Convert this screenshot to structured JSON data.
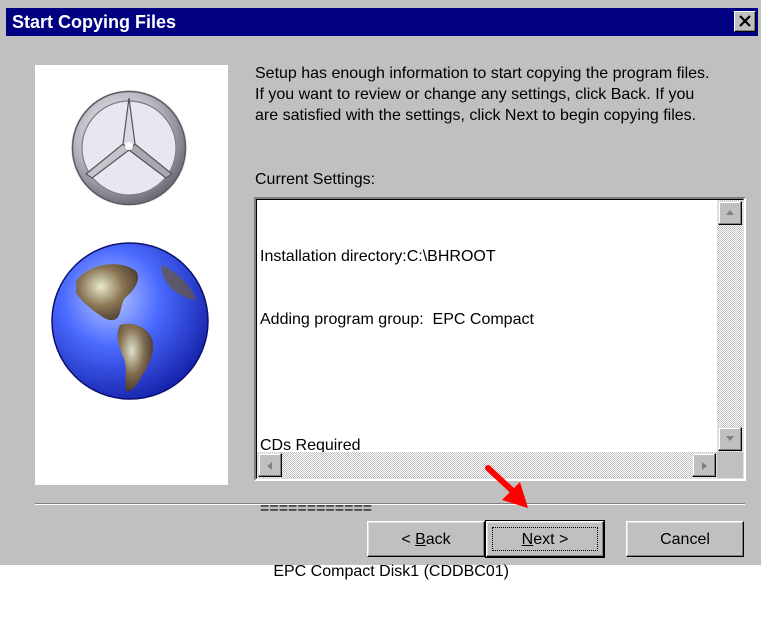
{
  "window": {
    "title": "Start Copying Files",
    "title_bar_color": "#000080",
    "background_color": "#c0c0c0"
  },
  "intro": {
    "lines": [
      "Setup has enough information to start copying the program files.",
      "If you want to review or change any settings, click Back.  If you",
      "are satisfied with the settings, click Next to begin copying files."
    ]
  },
  "settings": {
    "label": "Current Settings:",
    "lines": [
      "Installation directory:C:\\BHROOT",
      "Adding program group:  EPC Compact",
      "",
      "CDs Required",
      "============",
      "   EPC Compact Disk1 (CDDBC01)"
    ]
  },
  "buttons": {
    "back": {
      "prefix": "< ",
      "accel": "B",
      "rest": "ack"
    },
    "next": {
      "accel": "N",
      "rest": "ext >"
    },
    "cancel": "Cancel"
  },
  "icons": {
    "close": "close-icon",
    "logo": "three-pointed-star-logo",
    "globe": "globe-image",
    "pointer": "red-arrow-icon",
    "pointer_color": "#ff0000"
  }
}
